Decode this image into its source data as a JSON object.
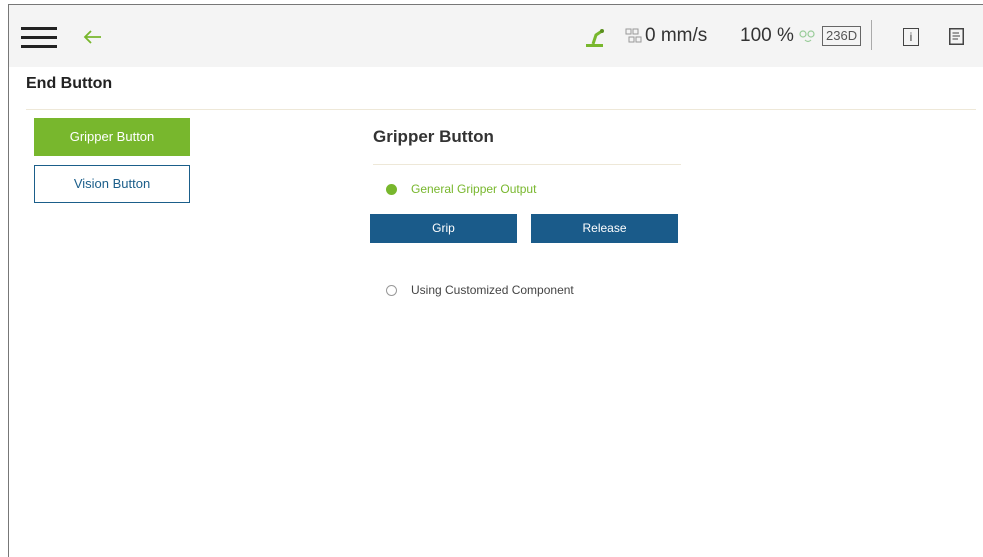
{
  "topbar": {
    "speed": "0 mm/s",
    "percent": "100 %",
    "id_badge": "236D",
    "info_glyph": "i",
    "icons": [
      "menu-icon",
      "back-arrow-icon",
      "robot-arm-icon",
      "speed-icon",
      "link-icon",
      "info-icon",
      "document-icon"
    ]
  },
  "page": {
    "title": "End Button"
  },
  "sidebar": {
    "items": [
      {
        "label": "Gripper Button",
        "active": true
      },
      {
        "label": "Vision Button",
        "active": false
      }
    ]
  },
  "main": {
    "section_title": "Gripper Button",
    "options": [
      {
        "label": "General Gripper Output",
        "selected": true
      },
      {
        "label": "Using Customized Component",
        "selected": false
      }
    ],
    "buttons": {
      "grip": "Grip",
      "release": "Release"
    }
  },
  "colors": {
    "accent_green": "#78b72d",
    "action_blue": "#1a5b8a"
  }
}
